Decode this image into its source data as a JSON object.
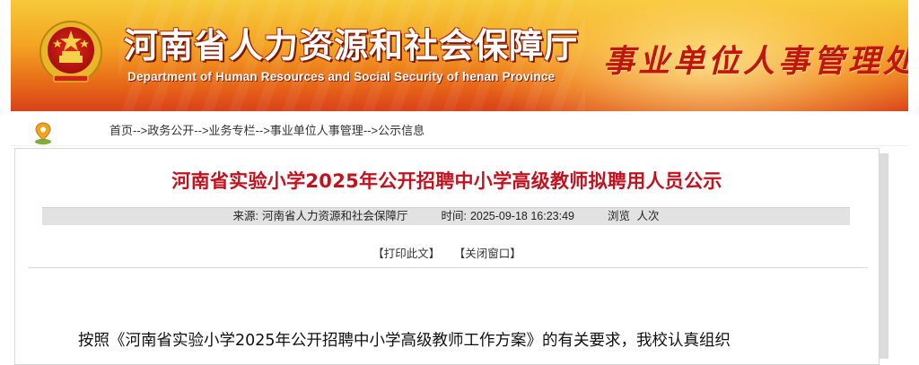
{
  "header": {
    "title_cn": "河南省人力资源和社会保障厅",
    "title_en": "Department of Human Resources and Social Security of henan Province",
    "department_cn": "事业单位人事管理处",
    "emblem_icon": "national-emblem-icon",
    "colors": {
      "banner_top": "#f6c93a",
      "banner_bottom": "#d9411a",
      "department_text": "#c0170d"
    }
  },
  "breadcrumb": {
    "pin_icon": "location-pin-icon",
    "items": [
      "首页",
      "政务公开",
      "业务专栏",
      "事业单位人事管理",
      "公示信息"
    ],
    "separator": "-->"
  },
  "article": {
    "title": "河南省实验小学2025年公开招聘中小学高级教师拟聘用人员公示",
    "meta": {
      "source_label": "来源:",
      "source_value": "河南省人力资源和社会保障厅",
      "time_label": "时间:",
      "time_value": "2025-09-18 16:23:49",
      "views_label": "浏览",
      "views_unit": "人次"
    },
    "actions": {
      "print": "【打印此文】",
      "close": "【关闭窗口】"
    },
    "body_first_line": "按照《河南省实验小学2025年公开招聘中小学高级教师工作方案》的有关要求，我校认真组织",
    "colors": {
      "title": "#c1121f"
    }
  }
}
